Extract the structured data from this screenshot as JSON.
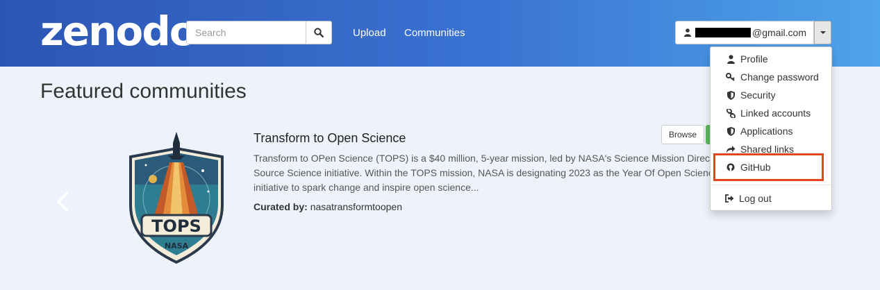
{
  "header": {
    "logo": "zenodo",
    "search": {
      "placeholder": "Search"
    },
    "nav": {
      "upload": "Upload",
      "communities": "Communities"
    },
    "user": {
      "email_suffix": "@gmail.com"
    }
  },
  "dropdown": {
    "items": [
      {
        "label": "Profile",
        "icon": "user-icon"
      },
      {
        "label": "Change password",
        "icon": "key-icon"
      },
      {
        "label": "Security",
        "icon": "shield-icon"
      },
      {
        "label": "Linked accounts",
        "icon": "link-icon"
      },
      {
        "label": "Applications",
        "icon": "shield-icon"
      },
      {
        "label": "Shared links",
        "icon": "share-icon"
      },
      {
        "label": "GitHub",
        "icon": "github-icon"
      },
      {
        "label": "Log out",
        "icon": "sign-out-icon"
      }
    ]
  },
  "main": {
    "title": "Featured communities",
    "community": {
      "name": "Transform to Open Science",
      "description_lines": [
        "Transform to OPen Science (TOPS) is a $40 million, 5-year mission, led by NASA's Science Mission Directorat",
        "Source Science initiative.  Within the TOPS mission, NASA is designating 2023 as the Year Of Open Science, a",
        "initiative to spark change and inspire open science..."
      ],
      "curated_label": "Curated by:",
      "curator": "nasatransformtoopen",
      "browse_label": "Browse",
      "badge_text": "TOPS",
      "badge_subtext": "NASA"
    }
  },
  "colors": {
    "header_start": "#2d55b4",
    "header_end": "#4ea4ea",
    "highlight": "#e2461f",
    "green_button": "#5cb85c"
  }
}
